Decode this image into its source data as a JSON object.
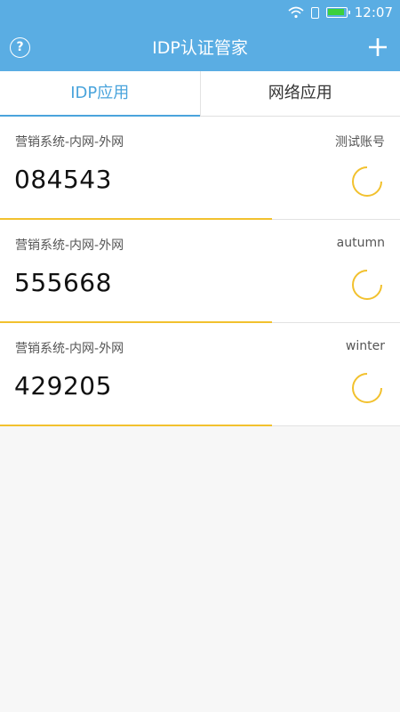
{
  "status_bar": {
    "time": "12:07",
    "battery_level": 0.95
  },
  "header": {
    "title": "IDP认证管家",
    "help_icon": "?"
  },
  "tabs": [
    {
      "label": "IDP应用",
      "active": true
    },
    {
      "label": "网络应用",
      "active": false
    }
  ],
  "tokens": [
    {
      "app_name": "营销系统-内网-外网",
      "account": "测试账号",
      "code": "084543",
      "progress": 0.68,
      "timer_remaining": 0.75
    },
    {
      "app_name": "营销系统-内网-外网",
      "account": "autumn",
      "code": "555668",
      "progress": 0.68,
      "timer_remaining": 0.75
    },
    {
      "app_name": "营销系统-内网-外网",
      "account": "winter",
      "code": "429205",
      "progress": 0.68,
      "timer_remaining": 0.75
    }
  ],
  "colors": {
    "primary": "#5aade3",
    "tab_active": "#4aa4dc",
    "progress": "#f2c12e",
    "battery": "#3cd03c"
  }
}
